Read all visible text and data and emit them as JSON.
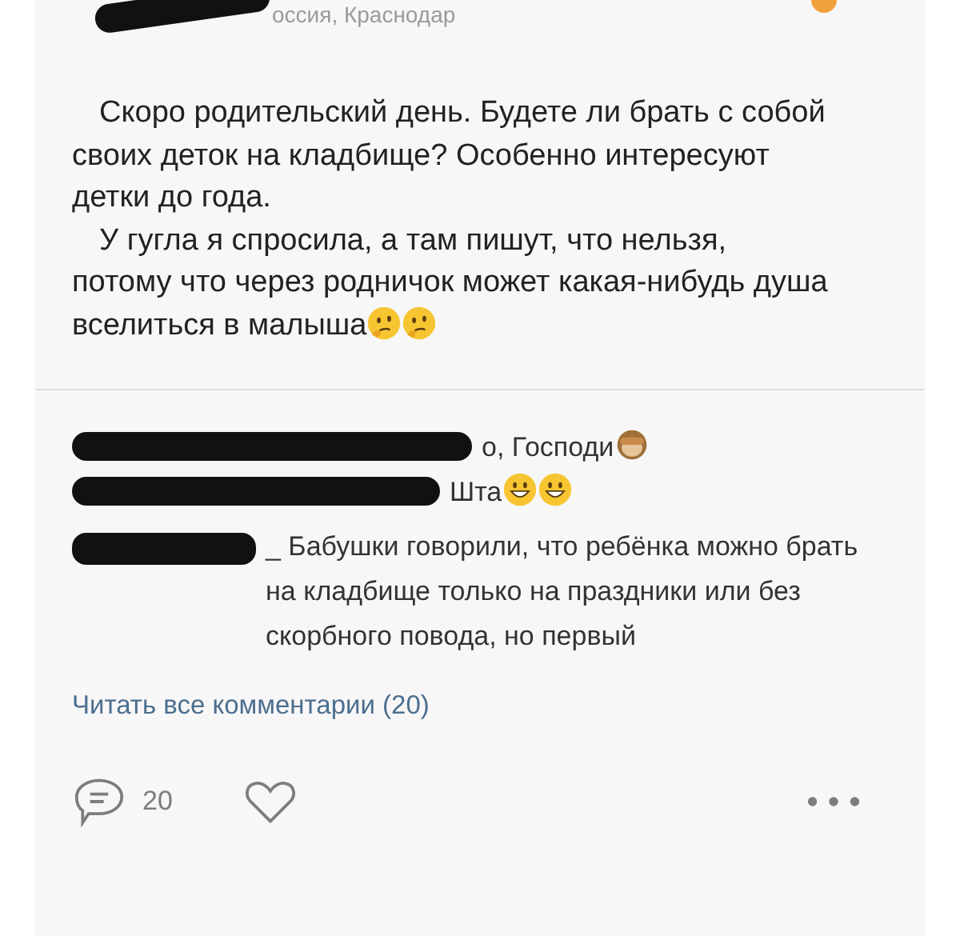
{
  "header": {
    "location": "оссия, Краснодар"
  },
  "post": {
    "paragraphs": [
      {
        "text": "Скоро родительский день. Будете ли брать с собой своих деток на кладбище? Особенно интересуют детки до года."
      },
      {
        "text": "У гугла я спросила, а там пишут, что нельзя, потому что через родничок может какая-нибудь душа вселиться в малыша"
      }
    ]
  },
  "comments": [
    {
      "kind": "hidden",
      "text": "о, Господи"
    },
    {
      "kind": "hidden",
      "text": "Шта"
    },
    {
      "kind": "partial",
      "username": "_",
      "text": "Бабушки говорили, что ребёнка можно брать на кладбище только на праздники или без скорбного повода, но первый"
    }
  ],
  "view_all": "Читать все комментарии (20)",
  "footer": {
    "comment_count": "20",
    "liked": false
  }
}
